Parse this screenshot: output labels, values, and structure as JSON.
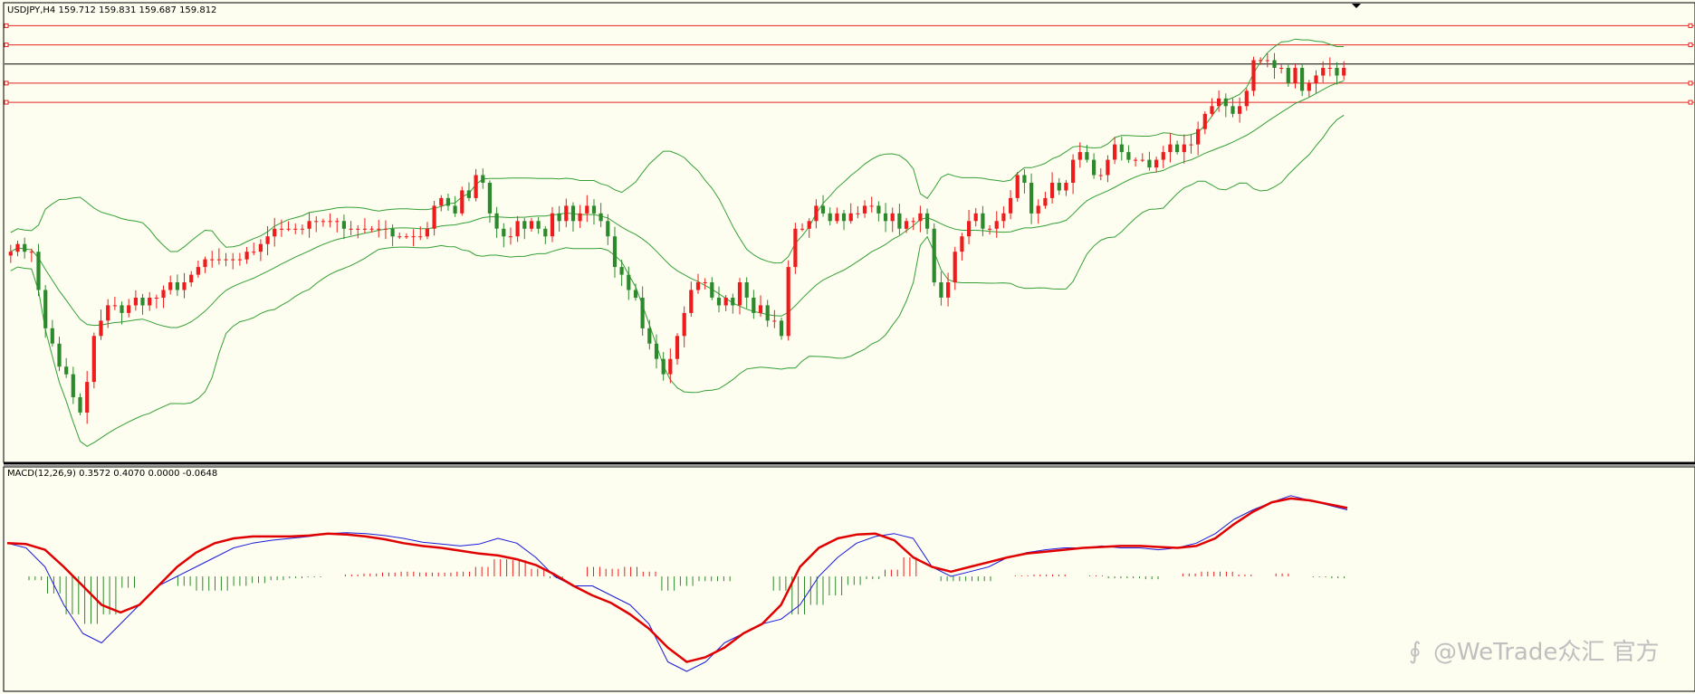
{
  "main": {
    "title_text": "USDJPY,H4  159.712 159.831 159.687 159.812"
  },
  "macd": {
    "title_text": "MACD(12,26,9) 0.3572 0.4070 0.0000 -0.0648"
  },
  "watermark": {
    "text": "@WeTrade众汇 官方"
  },
  "colors": {
    "background": "#fdfdf0",
    "bull": "#ee1c1c",
    "bear": "#2c8a2c",
    "bands": "#35a035",
    "hline": "#e62222",
    "hline_black": "#000000",
    "macd_line": "#1a1adc",
    "signal_line": "#e00000"
  },
  "chart_data": [
    {
      "type": "candlestick",
      "symbol": "USDJPY",
      "timeframe": "H4",
      "bollinger_bands": true,
      "ylim": [
        154.25,
        160.25
      ],
      "horizontal_lines": [
        {
          "price": 159.95,
          "color": "red"
        },
        {
          "price": 159.7,
          "color": "red"
        },
        {
          "price": 159.45,
          "color": "black"
        },
        {
          "price": 159.2,
          "color": "red"
        },
        {
          "price": 158.95,
          "color": "red"
        }
      ],
      "close": [
        157.0,
        157.1,
        157.0,
        157.0,
        156.5,
        156.0,
        155.8,
        155.5,
        155.4,
        155.1,
        154.9,
        155.3,
        155.9,
        156.1,
        156.3,
        156.3,
        156.2,
        156.3,
        156.4,
        156.3,
        156.4,
        156.4,
        156.5,
        156.6,
        156.5,
        156.6,
        156.7,
        156.8,
        156.9,
        156.9,
        156.9,
        156.9,
        156.9,
        156.9,
        157.0,
        157.0,
        157.1,
        157.2,
        157.3,
        157.3,
        157.3,
        157.3,
        157.3,
        157.4,
        157.4,
        157.4,
        157.4,
        157.4,
        157.3,
        157.3,
        157.3,
        157.3,
        157.3,
        157.3,
        157.3,
        157.2,
        157.2,
        157.2,
        157.2,
        157.2,
        157.3,
        157.6,
        157.7,
        157.6,
        157.5,
        157.8,
        157.7,
        158.0,
        157.9,
        157.5,
        157.3,
        157.2,
        157.2,
        157.4,
        157.3,
        157.4,
        157.3,
        157.2,
        157.5,
        157.4,
        157.6,
        157.4,
        157.5,
        157.6,
        157.5,
        157.4,
        157.2,
        156.8,
        156.7,
        156.5,
        156.4,
        156.0,
        155.8,
        155.6,
        155.4,
        155.6,
        155.9,
        156.2,
        156.5,
        156.6,
        156.6,
        156.4,
        156.3,
        156.4,
        156.3,
        156.6,
        156.4,
        156.2,
        156.3,
        156.1,
        156.1,
        155.9,
        156.8,
        157.3,
        157.3,
        157.4,
        157.6,
        157.5,
        157.4,
        157.5,
        157.4,
        157.5,
        157.5,
        157.6,
        157.6,
        157.5,
        157.4,
        157.5,
        157.3,
        157.4,
        157.4,
        157.5,
        157.3,
        156.6,
        156.4,
        156.6,
        157.0,
        157.2,
        157.4,
        157.5,
        157.3,
        157.3,
        157.4,
        157.5,
        157.7,
        158.0,
        157.9,
        157.5,
        157.6,
        157.7,
        157.9,
        157.8,
        157.9,
        158.2,
        158.3,
        158.2,
        158.0,
        158.0,
        158.2,
        158.4,
        158.3,
        158.2,
        158.2,
        158.2,
        158.1,
        158.2,
        158.3,
        158.4,
        158.3,
        158.4,
        158.4,
        158.6,
        158.8,
        158.9,
        159.0,
        158.9,
        158.8,
        158.9,
        159.1,
        159.5,
        159.5,
        159.5,
        159.4,
        159.4,
        159.2,
        159.4,
        159.1,
        159.2,
        159.3,
        159.4,
        159.4,
        159.3,
        159.4
      ]
    },
    {
      "type": "macd",
      "params": "MACD(12,26,9)",
      "macd_line": [
        0.35,
        0.3,
        0.1,
        -0.3,
        -0.6,
        -0.7,
        -0.5,
        -0.3,
        -0.1,
        0.0,
        0.1,
        0.2,
        0.3,
        0.35,
        0.38,
        0.4,
        0.42,
        0.45,
        0.46,
        0.45,
        0.43,
        0.4,
        0.36,
        0.34,
        0.32,
        0.34,
        0.4,
        0.35,
        0.2,
        0.0,
        -0.1,
        -0.1,
        -0.2,
        -0.3,
        -0.5,
        -0.9,
        -1.0,
        -0.9,
        -0.7,
        -0.6,
        -0.5,
        -0.45,
        -0.3,
        0.0,
        0.2,
        0.35,
        0.42,
        0.45,
        0.4,
        0.1,
        0.0,
        0.05,
        0.1,
        0.2,
        0.25,
        0.28,
        0.3,
        0.3,
        0.32,
        0.3,
        0.3,
        0.28,
        0.3,
        0.35,
        0.45,
        0.6,
        0.7,
        0.78,
        0.85,
        0.8,
        0.75,
        0.7
      ],
      "signal_line": [
        0.35,
        0.34,
        0.28,
        0.1,
        -0.1,
        -0.3,
        -0.38,
        -0.3,
        -0.1,
        0.1,
        0.25,
        0.35,
        0.4,
        0.42,
        0.42,
        0.42,
        0.43,
        0.45,
        0.44,
        0.42,
        0.39,
        0.35,
        0.32,
        0.3,
        0.27,
        0.24,
        0.22,
        0.18,
        0.12,
        0.02,
        -0.1,
        -0.2,
        -0.28,
        -0.4,
        -0.55,
        -0.75,
        -0.9,
        -0.85,
        -0.75,
        -0.6,
        -0.5,
        -0.3,
        0.1,
        0.3,
        0.4,
        0.44,
        0.45,
        0.38,
        0.2,
        0.1,
        0.05,
        0.1,
        0.15,
        0.2,
        0.24,
        0.26,
        0.28,
        0.3,
        0.31,
        0.32,
        0.32,
        0.31,
        0.3,
        0.32,
        0.4,
        0.55,
        0.68,
        0.78,
        0.82,
        0.8,
        0.76,
        0.72
      ],
      "histogram": [
        0.0,
        -0.04,
        -0.18,
        -0.4,
        -0.5,
        -0.4,
        -0.12,
        0.0,
        0.0,
        -0.1,
        -0.15,
        -0.15,
        -0.1,
        -0.07,
        -0.04,
        -0.02,
        -0.01,
        0.0,
        0.02,
        0.03,
        0.04,
        0.05,
        0.04,
        0.04,
        0.05,
        0.1,
        0.18,
        0.17,
        0.08,
        -0.02,
        0.0,
        0.1,
        0.08,
        0.1,
        0.05,
        -0.15,
        -0.1,
        -0.05,
        -0.05,
        0.0,
        0.0,
        -0.15,
        -0.4,
        -0.3,
        -0.2,
        -0.09,
        -0.03,
        0.07,
        0.2,
        0.0,
        -0.05,
        -0.05,
        -0.05,
        0.0,
        0.01,
        0.02,
        0.02,
        0.0,
        0.01,
        -0.02,
        -0.02,
        -0.03,
        0.0,
        0.03,
        0.05,
        0.05,
        0.02,
        0.0,
        0.03,
        0.0,
        -0.01,
        -0.02
      ]
    }
  ]
}
